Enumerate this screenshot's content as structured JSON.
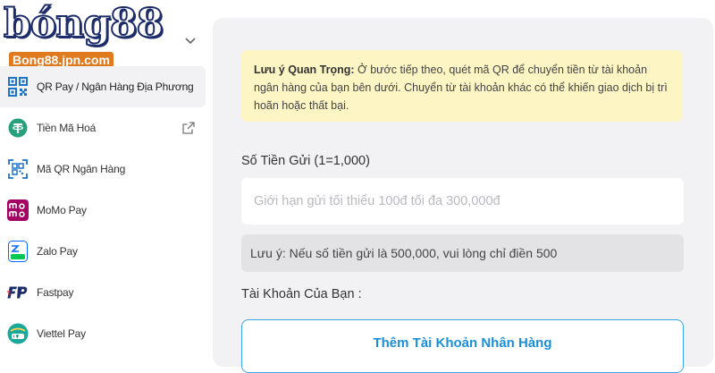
{
  "brand": {
    "logo_text": "bóng88",
    "logo_domain": "Bong88.jpn.com"
  },
  "sidebar": {
    "items": [
      {
        "label": "QR Pay / Ngân Hàng Địa Phương",
        "icon": "qr-code-icon",
        "active": true
      },
      {
        "label": "Tiền Mã Hoá",
        "icon": "tether-icon",
        "active": false,
        "external": true
      },
      {
        "label": "Mã QR Ngân Hàng",
        "icon": "qr-scan-icon",
        "active": false
      },
      {
        "label": "MoMo Pay",
        "icon": "momo-icon",
        "active": false
      },
      {
        "label": "Zalo Pay",
        "icon": "zalopay-icon",
        "active": false
      },
      {
        "label": "Fastpay",
        "icon": "fastpay-icon",
        "active": false
      },
      {
        "label": "Viettel Pay",
        "icon": "viettelpay-icon",
        "active": false
      }
    ]
  },
  "notice": {
    "title": "Lưu ý Quan Trọng:",
    "body": "Ở bước tiếp theo, quét mã QR để chuyển tiền từ tài khoản ngân hàng của bạn bên dưới. Chuyển từ tài khoản khác có thể khiến giao dịch bị trì hoãn hoặc thất bại."
  },
  "deposit": {
    "amount_label": "Số Tiền Gửi (1=1,000)",
    "amount_value": "",
    "amount_placeholder": "Giới hạn gửi tối thiểu 100đ tối đa 300,000đ",
    "hint": "Lưu ý: Nếu số tiền gửi là 500,000, vui lòng chỉ điền 500"
  },
  "account": {
    "label": "Tài Khoản Của Bạn :",
    "add_button": "Thêm Tài Khoản Nhân Hàng"
  },
  "colors": {
    "accent": "#1a8fd8",
    "notice_bg": "#fdf5c4",
    "panel_bg": "#f2f2f4",
    "tether": "#26a17b",
    "momo": "#a50064",
    "zalo": "#0068ff",
    "viettel": "#1aa89a"
  }
}
